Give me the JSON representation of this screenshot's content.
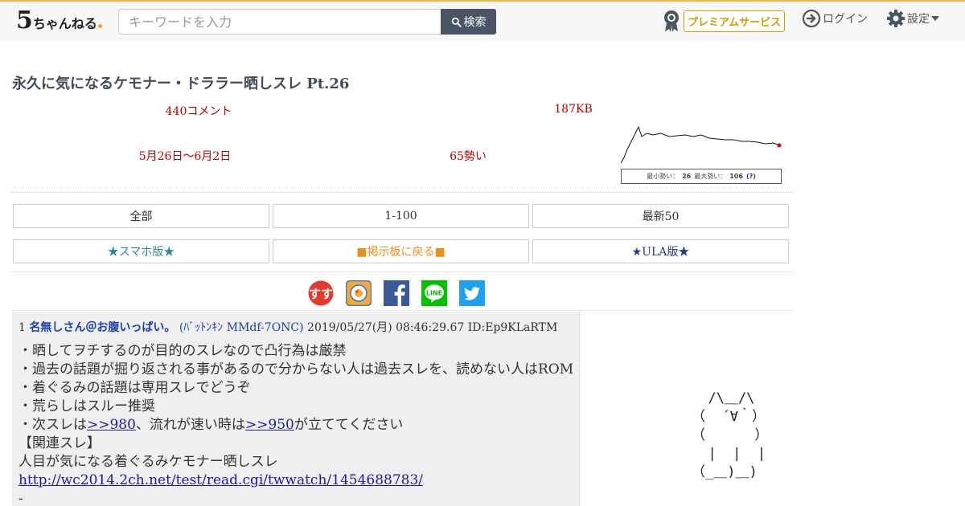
{
  "header": {
    "logo_five": "5",
    "logo_text": "ちゃんねる",
    "search_placeholder": "キーワードを入力",
    "search_label": "検索",
    "premium_label": "プレミアムサービス",
    "login_label": "ログイン",
    "settings_label": "設定"
  },
  "thread": {
    "title": "永久に気になるケモナー・ドララー晒しスレ Pt.26",
    "comments": "440コメント",
    "size": "187KB",
    "date_range": "5月26日〜6月2日",
    "momentum": "65勢い"
  },
  "graph": {
    "min_label": "最小勢い：",
    "min_value": "26",
    "max_label": "最大勢い：",
    "max_value": "106",
    "help": "(?)",
    "line_color": "#111111",
    "end_marker_color": "#dd0000"
  },
  "nav": {
    "all": "全部",
    "range": "1-100",
    "latest": "最新50",
    "smartphone": "★スマホ版★",
    "back_to_board": "■掲示板に戻る■",
    "ula": "★ULA版★"
  },
  "colors": {
    "smartphone": "#2a8a9a",
    "back_to_board": "#e8901a",
    "ula": "#223a7a"
  },
  "share": {
    "sumaho": "すす",
    "facebook_icon": "facebook-icon",
    "line_label": "LINE",
    "twitter_icon": "twitter-icon"
  },
  "post": {
    "number": "1",
    "name": "名無しさん＠お腹いっぱい。",
    "trip": "(ﾊﾞｯﾄﾝｷﾝ MMdf-7ONC)",
    "datetime": "2019/05/27(月) 08:46:29.67",
    "id": "ID:Ep9KLaRTM",
    "line1": "・晒してヲチするのが目的のスレなので凸行為は厳禁",
    "line2": "・過去の話題が掘り返される事があるので分からない人は過去スレを、読めない人はROM",
    "line3": "・着ぐるみの話題は専用スレでどうぞ",
    "line4": "・荒らしはスルー推奨",
    "line5_a": "・次スレは",
    "line5_link1": ">>980",
    "line5_b": "、流れが速い時は",
    "line5_link2": ">>950",
    "line5_c": "が立ててください",
    "line6": "【関連スレ】",
    "line7": "人目が気になる着ぐるみケモナー晒しスレ",
    "line8_link": "http://wc2014.2ch.net/test/read.cgi/twwatch/1454688783/",
    "line9": "-"
  },
  "ascii_art": "  /\\＿/\\\n（  ´∀｀）\n（      ）\n  |  |  |\n（_＿)＿)"
}
